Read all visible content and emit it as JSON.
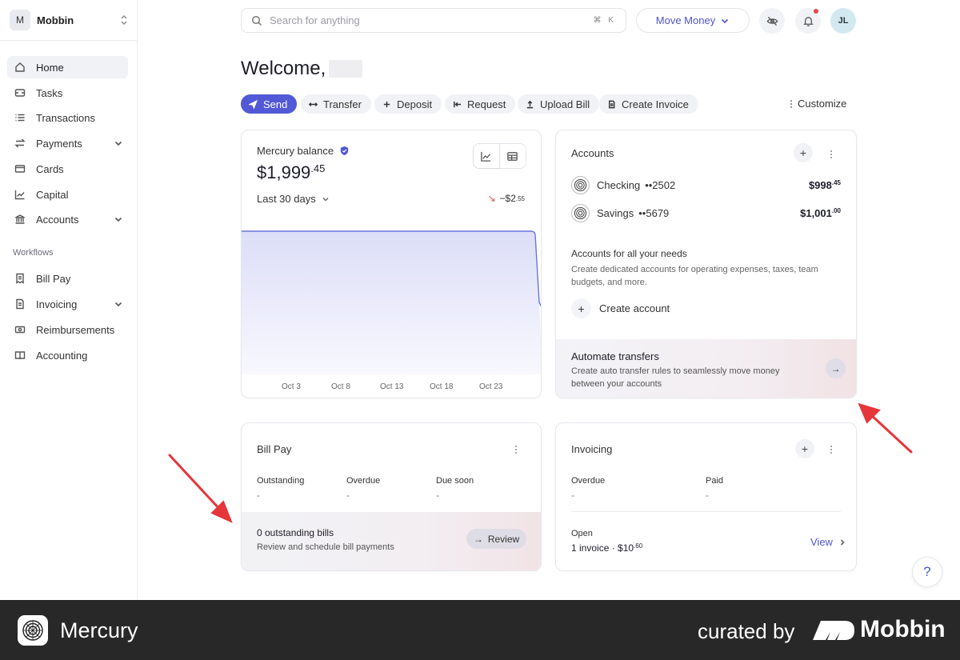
{
  "org": {
    "initial": "M",
    "name": "Mobbin"
  },
  "sidebar": {
    "items": [
      {
        "label": "Home",
        "icon": "home-icon",
        "active": true
      },
      {
        "label": "Tasks",
        "icon": "tasks-icon"
      },
      {
        "label": "Transactions",
        "icon": "list-icon"
      },
      {
        "label": "Payments",
        "icon": "arrows-icon",
        "expandable": true
      },
      {
        "label": "Cards",
        "icon": "card-icon"
      },
      {
        "label": "Capital",
        "icon": "chart-line-icon"
      },
      {
        "label": "Accounts",
        "icon": "bank-icon",
        "expandable": true
      }
    ],
    "section_label": "Workflows",
    "workflow_items": [
      {
        "label": "Bill Pay",
        "icon": "bill-icon"
      },
      {
        "label": "Invoicing",
        "icon": "invoice-icon",
        "expandable": true
      },
      {
        "label": "Reimbursements",
        "icon": "cash-icon"
      },
      {
        "label": "Accounting",
        "icon": "book-icon"
      }
    ]
  },
  "topbar": {
    "search_placeholder": "Search for anything",
    "shortcut": "⌘ K",
    "move_money_label": "Move Money",
    "avatar_initials": "JL",
    "accent_color": "#5159d6",
    "notification_dot_color": "#e5484d"
  },
  "welcome": {
    "text": "Welcome,"
  },
  "actions": {
    "send": "Send",
    "transfer": "Transfer",
    "deposit": "Deposit",
    "request": "Request",
    "upload_bill": "Upload Bill",
    "create_invoice": "Create Invoice",
    "customize": "Customize"
  },
  "balance": {
    "label": "Mercury balance",
    "amount": "$1,999",
    "cents": ".45",
    "period": "Last 30 days",
    "change": "−$2",
    "change_cents": ".55",
    "chart_ticks": [
      "Oct 3",
      "Oct 8",
      "Oct 13",
      "Oct 18",
      "Oct 23"
    ]
  },
  "accounts": {
    "title": "Accounts",
    "items": [
      {
        "name": "Checking",
        "number": "••2502",
        "amount": "$998",
        "cents": ".45"
      },
      {
        "name": "Savings",
        "number": "••5679",
        "amount": "$1,001",
        "cents": ".00"
      }
    ],
    "promo_title": "Accounts for all your needs",
    "promo_text": "Create dedicated accounts for operating expenses, taxes, team budgets, and more.",
    "create_label": "Create account",
    "automate_title": "Automate transfers",
    "automate_text": "Create auto transfer rules to seamlessly move money between your accounts"
  },
  "billpay": {
    "title": "Bill Pay",
    "stats": [
      {
        "label": "Outstanding",
        "value": "-"
      },
      {
        "label": "Overdue",
        "value": "-"
      },
      {
        "label": "Due soon",
        "value": "-"
      }
    ],
    "footer_title": "0 outstanding bills",
    "footer_text": "Review and schedule bill payments",
    "review_label": "Review"
  },
  "invoicing": {
    "title": "Invoicing",
    "stats": [
      {
        "label": "Overdue",
        "value": "-"
      },
      {
        "label": "Paid",
        "value": "-"
      }
    ],
    "open_label": "Open",
    "open_value": "1 invoice · $10",
    "open_cents": ".60",
    "view_label": "View"
  },
  "help": {
    "label": "?"
  },
  "footer": {
    "brand": "Mercury",
    "curated": "curated by",
    "mobbin": "Mobbin"
  }
}
